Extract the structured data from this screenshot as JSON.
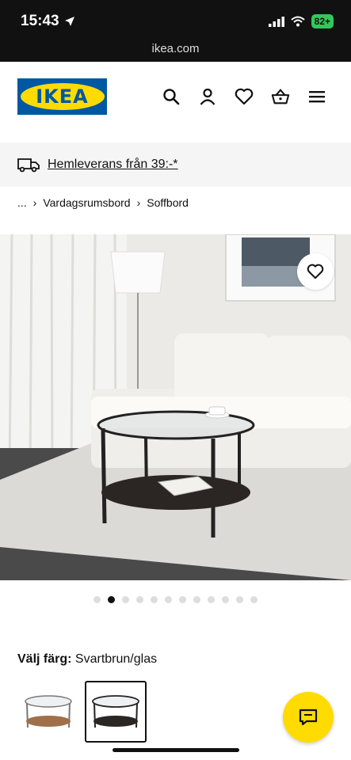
{
  "status_bar": {
    "time": "15:43",
    "battery": "82+",
    "url": "ikea.com"
  },
  "header": {
    "logo_text": "IKEA"
  },
  "banner": {
    "text": "Hemleverans från 39:-*"
  },
  "breadcrumb": {
    "ellipsis": "...",
    "items": [
      "Vardagsrumsbord",
      "Soffbord"
    ]
  },
  "gallery": {
    "total_images": 12,
    "active_index": 1
  },
  "color": {
    "label": "Välj färg:",
    "value": "Svartbrun/glas"
  },
  "colors": {
    "ikea_blue": "#0058a3",
    "ikea_yellow": "#ffdb00"
  }
}
